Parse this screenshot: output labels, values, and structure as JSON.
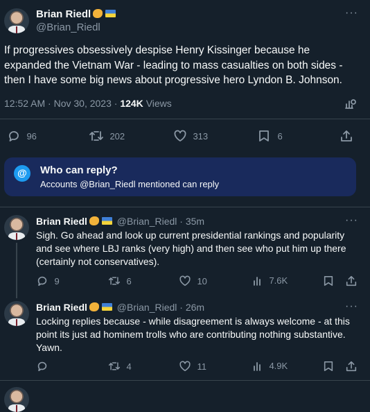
{
  "main_tweet": {
    "name": "Brian Riedl",
    "handle": "@Brian_Riedl",
    "text": "If progressives obsessively despise Henry Kissinger because he expanded the Vietnam War - leading to mass casualties on both sides - then I have some big news about progressive hero Lyndon B. Johnson.",
    "timestamp": "12:52 AM · Nov 30, 2023 · ",
    "views_count": "124K",
    "views_label": "Views",
    "replies": "96",
    "retweets": "202",
    "likes": "313",
    "bookmarks": "6"
  },
  "reply_notice": {
    "title": "Who can reply?",
    "body": "Accounts @Brian_Riedl mentioned can reply",
    "icon": "at-icon",
    "accent": "#1d9bf0"
  },
  "replies": [
    {
      "name": "Brian Riedl",
      "handle": "@Brian_Riedl",
      "time": "· 35m",
      "text": "Sigh. Go ahead and look up current presidential rankings and popularity and see where LBJ ranks (very high) and then see who put him up there (certainly not conservatives).",
      "replies": "9",
      "retweets": "6",
      "likes": "10",
      "views": "7.6K"
    },
    {
      "name": "Brian Riedl",
      "handle": "@Brian_Riedl",
      "time": "· 26m",
      "text": "Locking replies because - while disagreement is always welcome - at this point its just ad hominem trolls who are contributing nothing substantive. Yawn.",
      "replies": "",
      "retweets": "4",
      "likes": "11",
      "views": "4.9K"
    }
  ],
  "colors": {
    "background": "#15202b",
    "muted": "#8b98a5",
    "border": "#38444d",
    "notice_bg": "#192a5c"
  }
}
